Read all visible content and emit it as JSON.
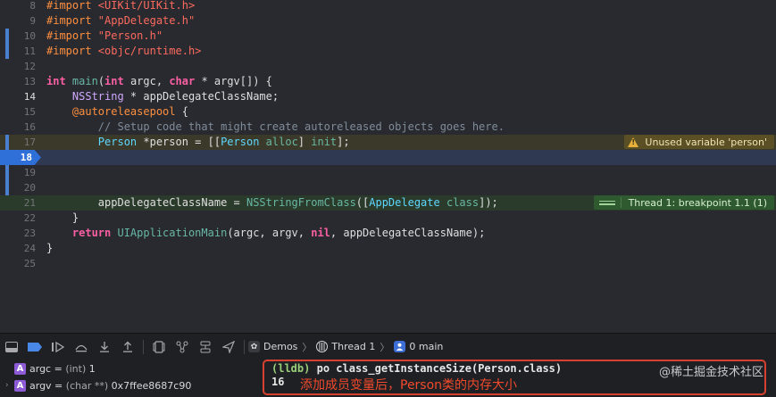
{
  "editor": {
    "lines": [
      {
        "num": "8",
        "segments": [
          {
            "t": "#import ",
            "c": "pp"
          },
          {
            "t": "<UIKit/UIKit.h>",
            "c": "str"
          }
        ]
      },
      {
        "num": "9",
        "segments": [
          {
            "t": "#import ",
            "c": "pp"
          },
          {
            "t": "\"AppDelegate.h\"",
            "c": "str"
          }
        ]
      },
      {
        "num": "10",
        "segments": [
          {
            "t": "#import ",
            "c": "pp"
          },
          {
            "t": "\"Person.h\"",
            "c": "str"
          }
        ]
      },
      {
        "num": "11",
        "segments": [
          {
            "t": "#import ",
            "c": "pp"
          },
          {
            "t": "<objc/runtime.h>",
            "c": "str"
          }
        ]
      },
      {
        "num": "12",
        "segments": []
      },
      {
        "num": "13",
        "segments": [
          {
            "t": "int ",
            "c": "kw"
          },
          {
            "t": "main",
            "c": "fn"
          },
          {
            "t": "(",
            "c": ""
          },
          {
            "t": "int ",
            "c": "kw"
          },
          {
            "t": "argc, ",
            "c": ""
          },
          {
            "t": "char ",
            "c": "kw"
          },
          {
            "t": "* argv[]) {",
            "c": ""
          }
        ]
      },
      {
        "num": "14",
        "segments": [
          {
            "t": "    ",
            "c": ""
          },
          {
            "t": "NSString",
            "c": "ty"
          },
          {
            "t": " * appDelegateClassName;",
            "c": ""
          }
        ]
      },
      {
        "num": "15",
        "segments": [
          {
            "t": "    ",
            "c": ""
          },
          {
            "t": "@autoreleasepool",
            "c": "at"
          },
          {
            "t": " {",
            "c": ""
          }
        ]
      },
      {
        "num": "16",
        "segments": [
          {
            "t": "        // Setup code that might create autoreleased objects goes here.",
            "c": "cm"
          }
        ]
      },
      {
        "num": "17",
        "segments": [
          {
            "t": "        ",
            "c": ""
          },
          {
            "t": "Person",
            "c": "tyb"
          },
          {
            "t": " *person = [[",
            "c": ""
          },
          {
            "t": "Person",
            "c": "tyb"
          },
          {
            "t": " ",
            "c": ""
          },
          {
            "t": "alloc",
            "c": "fn"
          },
          {
            "t": "] ",
            "c": ""
          },
          {
            "t": "init",
            "c": "fn"
          },
          {
            "t": "];",
            "c": ""
          }
        ]
      },
      {
        "num": "18",
        "segments": []
      },
      {
        "num": "19",
        "segments": []
      },
      {
        "num": "20",
        "segments": []
      },
      {
        "num": "21",
        "segments": [
          {
            "t": "        appDelegateClassName = ",
            "c": ""
          },
          {
            "t": "NSStringFromClass",
            "c": "fn"
          },
          {
            "t": "([",
            "c": ""
          },
          {
            "t": "AppDelegate",
            "c": "tyb"
          },
          {
            "t": " ",
            "c": ""
          },
          {
            "t": "class",
            "c": "fn"
          },
          {
            "t": "]);",
            "c": ""
          }
        ]
      },
      {
        "num": "22",
        "segments": [
          {
            "t": "    }",
            "c": ""
          }
        ]
      },
      {
        "num": "23",
        "segments": [
          {
            "t": "    ",
            "c": ""
          },
          {
            "t": "return ",
            "c": "kw"
          },
          {
            "t": "UIApplicationMain",
            "c": "fn"
          },
          {
            "t": "(argc, argv, ",
            "c": ""
          },
          {
            "t": "nil",
            "c": "kw"
          },
          {
            "t": ", appDelegateClassName);",
            "c": ""
          }
        ]
      },
      {
        "num": "24",
        "segments": [
          {
            "t": "}",
            "c": ""
          }
        ]
      },
      {
        "num": "25",
        "segments": []
      }
    ],
    "breakpoint_line": "18",
    "warning_text": "Unused variable 'person'",
    "thread_text": "Thread 1: breakpoint 1.1 (1)"
  },
  "toolbar": {
    "crumb_project": "Demos",
    "crumb_thread": "Thread 1",
    "crumb_frame": "0 main"
  },
  "variables": [
    {
      "name": "argc",
      "type": "(int)",
      "value": "1",
      "expandable": false
    },
    {
      "name": "argv",
      "type": "(char **)",
      "value": "0x7ffee8687c90",
      "expandable": true
    }
  ],
  "console": {
    "prompt": "(lldb)",
    "command": "po class_getInstanceSize(Person.class)",
    "output": "16",
    "annotation": "添加成员变量后，Person类的内存大小",
    "watermark": "@稀土掘金技术社区"
  }
}
